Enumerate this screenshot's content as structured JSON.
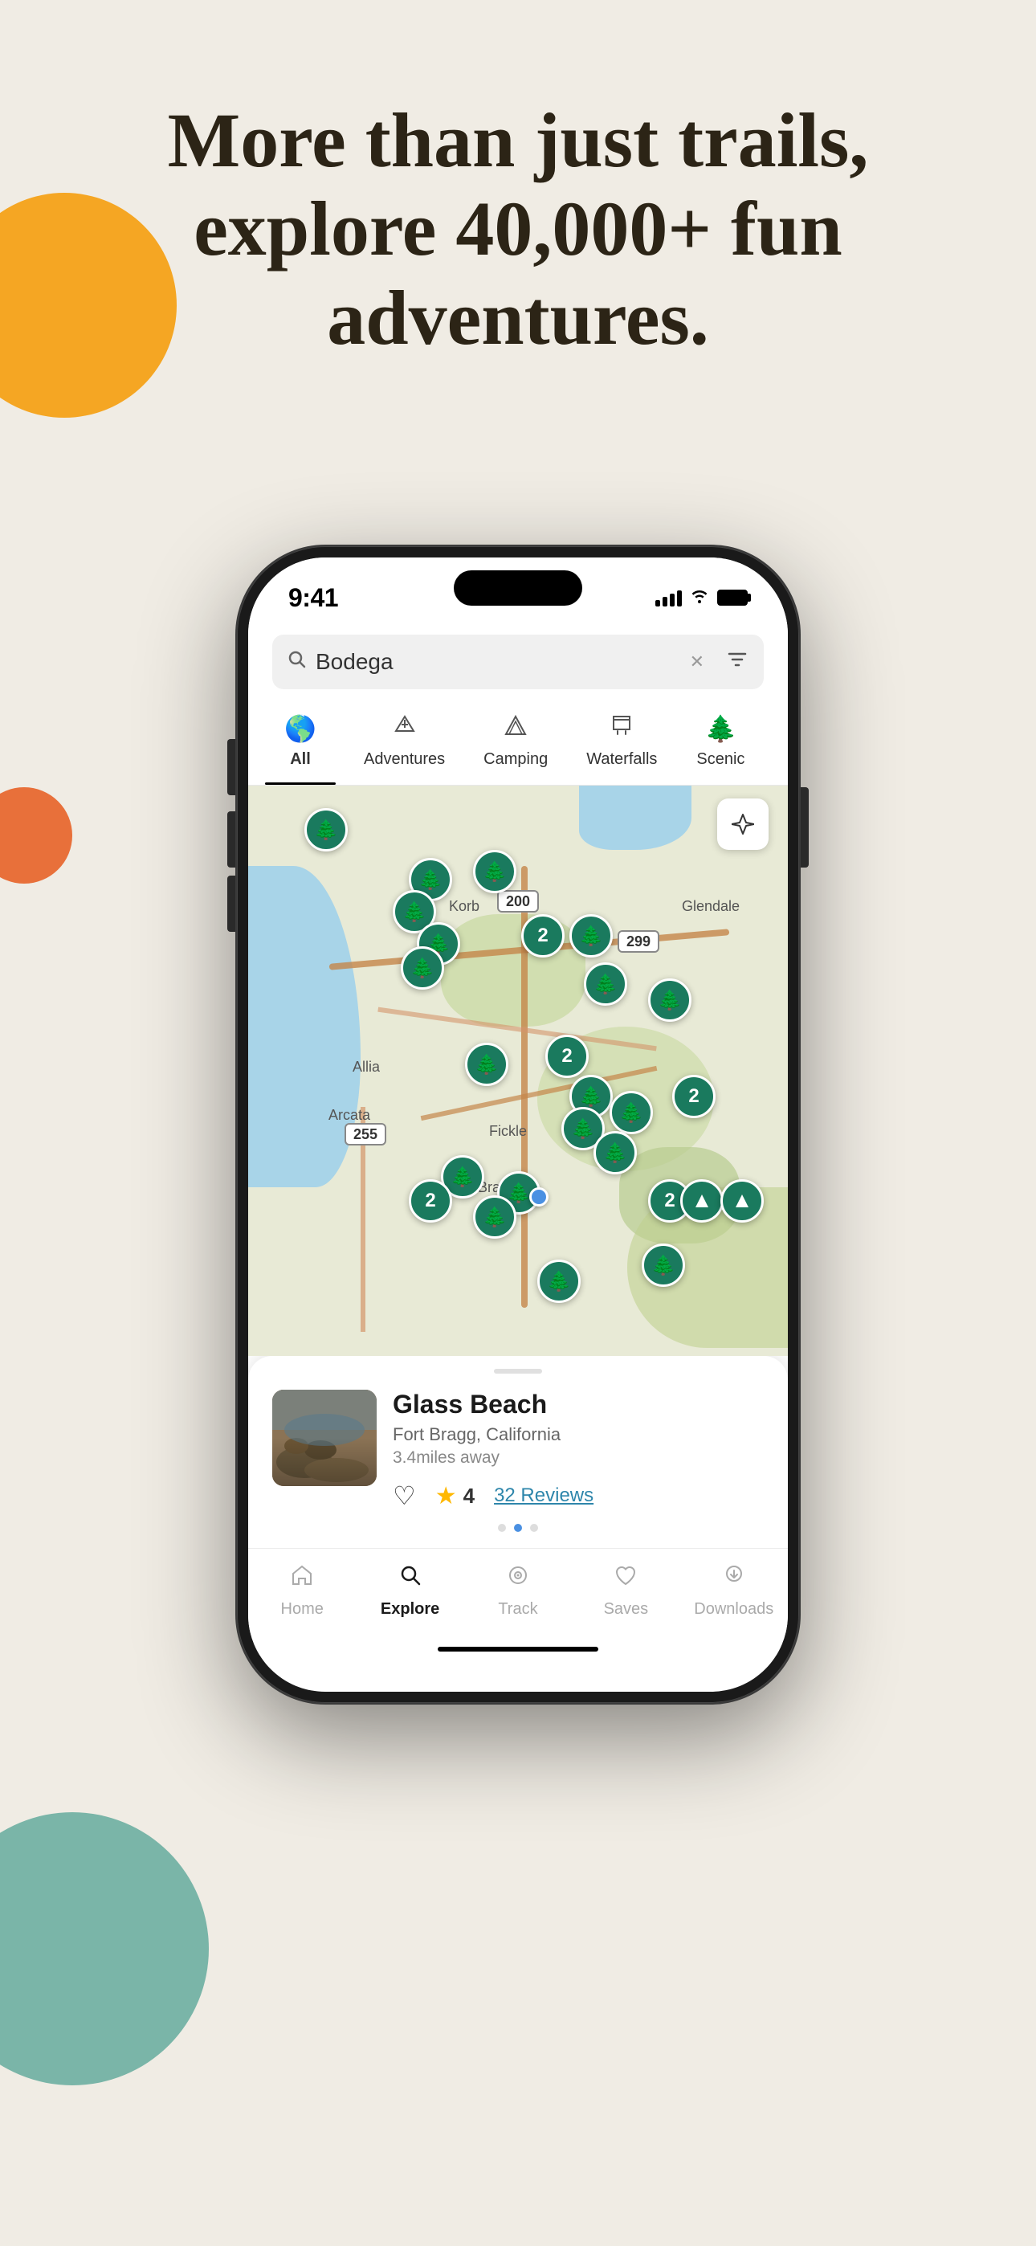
{
  "background": {
    "color": "#f0ece4"
  },
  "headline": {
    "line1": "More than just trails,",
    "line2": "explore 40,000+ fun",
    "line3": "adventures."
  },
  "phone": {
    "status_bar": {
      "time": "9:41",
      "signal": "signal",
      "wifi": "wifi",
      "battery": "battery"
    },
    "search": {
      "placeholder": "Search",
      "value": "Bodega",
      "filter_icon": "filter"
    },
    "categories": [
      {
        "label": "All",
        "icon": "🌎",
        "active": true
      },
      {
        "label": "Adventures",
        "icon": "✳️",
        "active": false
      },
      {
        "label": "Camping",
        "icon": "⛺",
        "active": false
      },
      {
        "label": "Waterfalls",
        "icon": "⛩",
        "active": false
      },
      {
        "label": "Scenic",
        "icon": "🌲",
        "active": false
      }
    ],
    "map": {
      "labels": [
        "Korb",
        "Glendale",
        "Arcata",
        "Allia",
        "Fickle",
        "Sunny Bra"
      ],
      "user_location": "user_dot"
    },
    "place_card": {
      "name": "Glass Beach",
      "location": "Fort Bragg, California",
      "distance": "3.4miles away",
      "rating": "4",
      "reviews": "32 Reviews",
      "reviews_count": 32,
      "dots": [
        "inactive",
        "active",
        "inactive"
      ]
    },
    "bottom_nav": [
      {
        "label": "Home",
        "icon": "home",
        "active": false
      },
      {
        "label": "Explore",
        "icon": "search",
        "active": true
      },
      {
        "label": "Track",
        "icon": "track",
        "active": false
      },
      {
        "label": "Saves",
        "icon": "heart",
        "active": false
      },
      {
        "label": "Downloads",
        "icon": "download",
        "active": false
      }
    ]
  }
}
